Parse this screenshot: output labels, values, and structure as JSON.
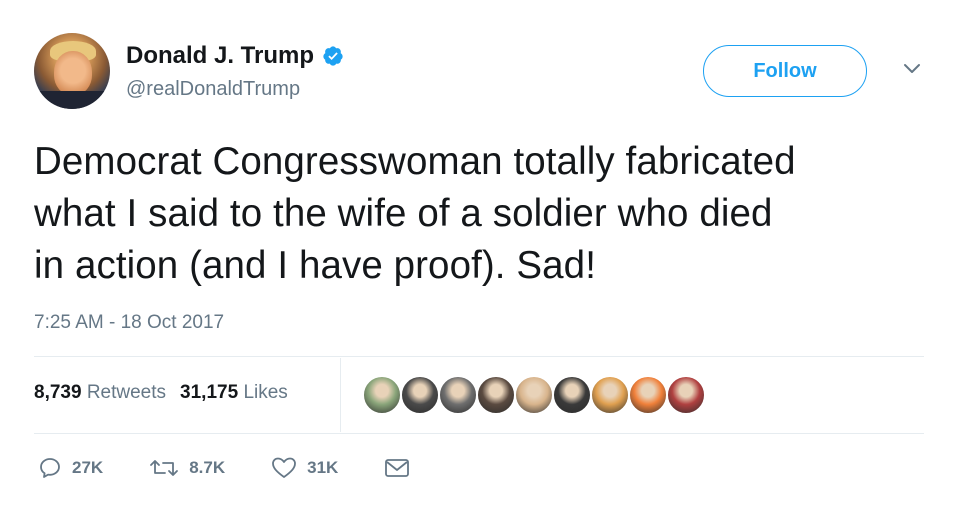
{
  "author": {
    "name": "Donald J. Trump",
    "handle": "@realDonaldTrump",
    "verified": true
  },
  "follow_label": "Follow",
  "tweet": {
    "text_lines": [
      "Democrat Congresswoman totally fabricated",
      "what I said to the wife of a soldier who died",
      "in action (and I have proof). Sad!"
    ],
    "timestamp": "7:25 AM - 18 Oct 2017"
  },
  "stats": {
    "retweets_count": "8,739",
    "retweets_label": "Retweets",
    "likes_count": "31,175",
    "likes_label": "Likes"
  },
  "likers": [
    {
      "color": "#8aa57a"
    },
    {
      "color": "#4a4a4a"
    },
    {
      "color": "#6e6e6e"
    },
    {
      "color": "#5a4a40"
    },
    {
      "color": "#d8b48c"
    },
    {
      "color": "#3a3a3a"
    },
    {
      "color": "#e0a050"
    },
    {
      "color": "#f0803a"
    },
    {
      "color": "#b04040"
    }
  ],
  "actions": {
    "reply": "27K",
    "retweet": "8.7K",
    "like": "31K"
  },
  "colors": {
    "accent": "#1da1f2",
    "muted": "#657786",
    "text": "#14171a",
    "divider": "#e6ecf0"
  }
}
